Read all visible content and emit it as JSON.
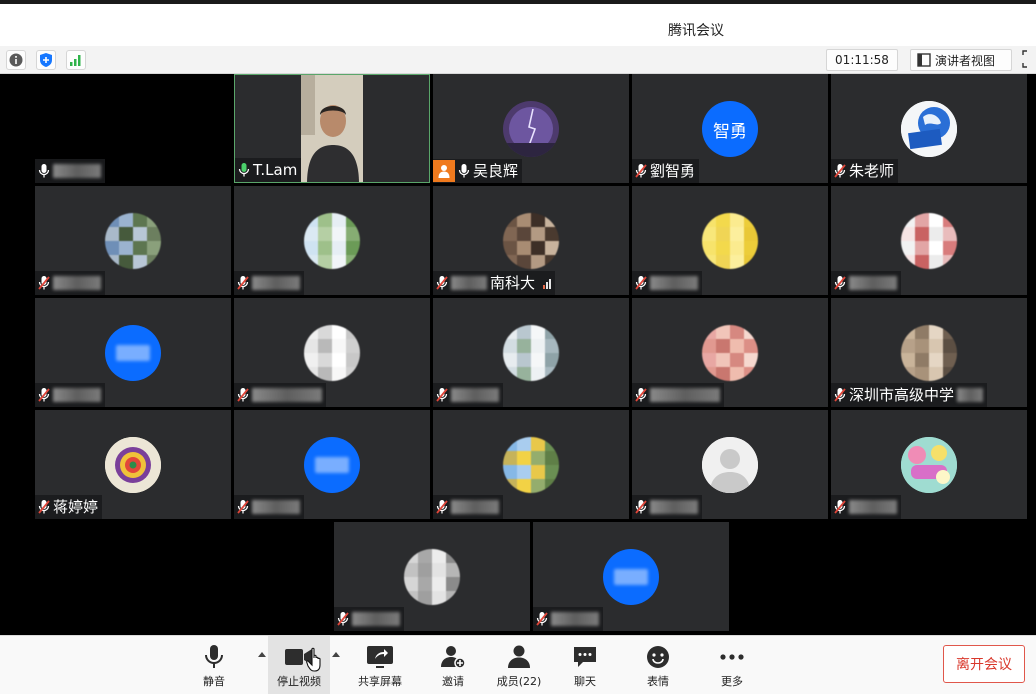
{
  "window": {
    "title": "腾讯会议"
  },
  "infobar": {
    "icons": [
      "info-icon",
      "shield-icon",
      "signal-icon"
    ],
    "timer": "01:11:58",
    "speaker_view_label": "演讲者视图"
  },
  "colors": {
    "tile_bg": "#2b2c2e",
    "avatar_blue": "#0b6cff",
    "host_badge": "#f07a1e",
    "mic_muted": "#e0463a",
    "leave_red": "#d9382c",
    "active_border": "#5aa66a"
  },
  "participants": [
    {
      "name": "",
      "obscured": true,
      "mic": "on",
      "avatar": "none",
      "tile": "blank"
    },
    {
      "name": "T.Lam",
      "obscured": false,
      "mic": "on-active",
      "avatar": "video"
    },
    {
      "name": "吴良辉",
      "obscured": false,
      "mic": "on",
      "avatar": "photo-purple",
      "host": true
    },
    {
      "name": "劉智勇",
      "obscured": false,
      "mic": "muted",
      "avatar": "blue-text",
      "avatar_text": "智勇"
    },
    {
      "name": "朱老师",
      "obscured": false,
      "mic": "muted",
      "avatar": "photo-globe"
    },
    {
      "name": "",
      "obscured": true,
      "mic": "muted",
      "avatar": "pixel-blue-green"
    },
    {
      "name": "",
      "obscured": true,
      "mic": "muted",
      "avatar": "pixel-sky-tree"
    },
    {
      "name": "南科大",
      "obscured": false,
      "prefix_obscured": true,
      "mic": "muted",
      "avatar": "pixel-brown",
      "signal": "weak"
    },
    {
      "name": "",
      "obscured": true,
      "mic": "muted",
      "avatar": "pixel-yellow"
    },
    {
      "name": "",
      "obscured": true,
      "mic": "muted",
      "avatar": "pixel-red-white"
    },
    {
      "name": "",
      "obscured": true,
      "mic": "muted",
      "avatar": "blue-text",
      "avatar_text": "",
      "avatar_text_obscured": true
    },
    {
      "name": "",
      "obscured": true,
      "mic": "muted",
      "avatar": "pixel-white",
      "long": true
    },
    {
      "name": "",
      "obscured": true,
      "mic": "muted",
      "avatar": "pixel-white-green"
    },
    {
      "name": "",
      "obscured": true,
      "mic": "muted",
      "avatar": "pixel-pink",
      "long": true
    },
    {
      "name": "深圳市高级中学",
      "obscured": false,
      "suffix_obscured": true,
      "mic": "muted",
      "avatar": "pixel-person"
    },
    {
      "name": "蒋婷婷",
      "obscured": false,
      "mic": "muted",
      "avatar": "photo-mandala"
    },
    {
      "name": "",
      "obscured": true,
      "mic": "muted",
      "avatar": "blue-text",
      "avatar_text": "学生",
      "avatar_text_obscured": true
    },
    {
      "name": "",
      "obscured": true,
      "mic": "muted",
      "avatar": "pixel-landscape"
    },
    {
      "name": "",
      "obscured": true,
      "mic": "muted",
      "avatar": "default-person"
    },
    {
      "name": "",
      "obscured": true,
      "mic": "muted",
      "avatar": "photo-colorful"
    },
    {
      "name": "",
      "obscured": true,
      "mic": "muted",
      "avatar": "pixel-grey-person"
    },
    {
      "name": "",
      "obscured": true,
      "mic": "muted",
      "avatar": "blue-text",
      "avatar_text": "",
      "avatar_text_obscured": true
    }
  ],
  "toolbar": {
    "mute_label": "静音",
    "stop_video_label": "停止视频",
    "share_label": "共享屏幕",
    "invite_label": "邀请",
    "members_label": "成员(22)",
    "chat_label": "聊天",
    "reactions_label": "表情",
    "more_label": "更多",
    "leave_label": "离开会议"
  }
}
